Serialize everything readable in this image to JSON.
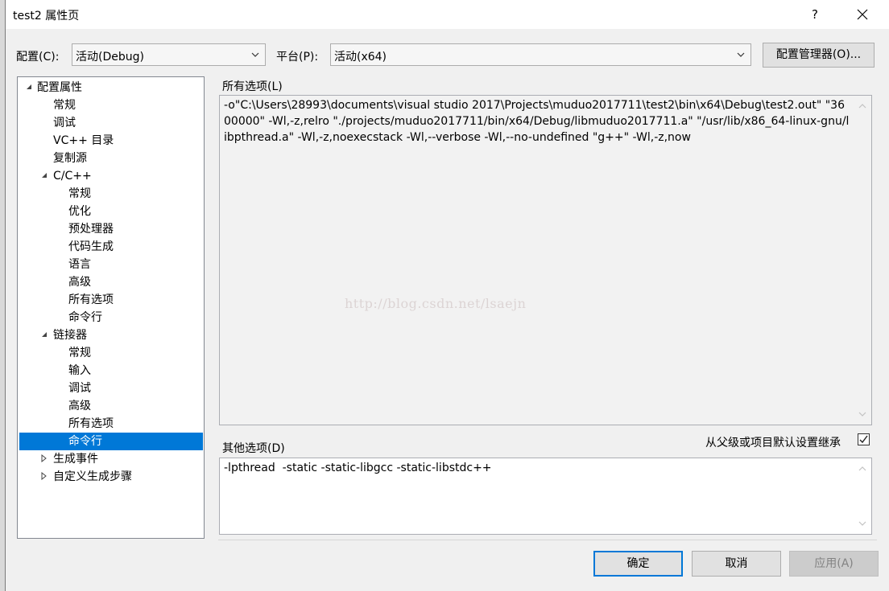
{
  "window": {
    "title": "test2 属性页",
    "help": "?"
  },
  "config": {
    "label": "配置(C):",
    "value": "活动(Debug)"
  },
  "platform": {
    "label": "平台(P):",
    "value": "活动(x64)"
  },
  "config_manager_label": "配置管理器(O)...",
  "tree": {
    "root": "配置属性",
    "items": [
      "常规",
      "调试",
      "VC++ 目录",
      "复制源"
    ],
    "cpp": {
      "label": "C/C++",
      "items": [
        "常规",
        "优化",
        "预处理器",
        "代码生成",
        "语言",
        "高级",
        "所有选项",
        "命令行"
      ]
    },
    "linker": {
      "label": "链接器",
      "items": [
        "常规",
        "输入",
        "调试",
        "高级",
        "所有选项",
        "命令行"
      ]
    },
    "build_events": "生成事件",
    "custom_build": "自定义生成步骤"
  },
  "all_options": {
    "label": "所有选项(L)",
    "text": "-o\"C:\\Users\\28993\\documents\\visual studio 2017\\Projects\\muduo2017711\\test2\\bin\\x64\\Debug\\test2.out\" \"3600000\" -Wl,-z,relro \"./projects/muduo2017711/bin/x64/Debug/libmuduo2017711.a\" \"/usr/lib/x86_64-linux-gnu/libpthread.a\" -Wl,-z,noexecstack -Wl,--verbose -Wl,--no-undefined \"g++\" -Wl,-z,now"
  },
  "watermark": "http://blog.csdn.net/lsaejn",
  "other_options": {
    "label": "其他选项(D)",
    "inherit_label": "从父级或项目默认设置继承",
    "inherit_checked": true,
    "text": "-lpthread  -static -static-libgcc -static-libstdc++"
  },
  "buttons": {
    "ok": "确定",
    "cancel": "取消",
    "apply": "应用(A)"
  }
}
